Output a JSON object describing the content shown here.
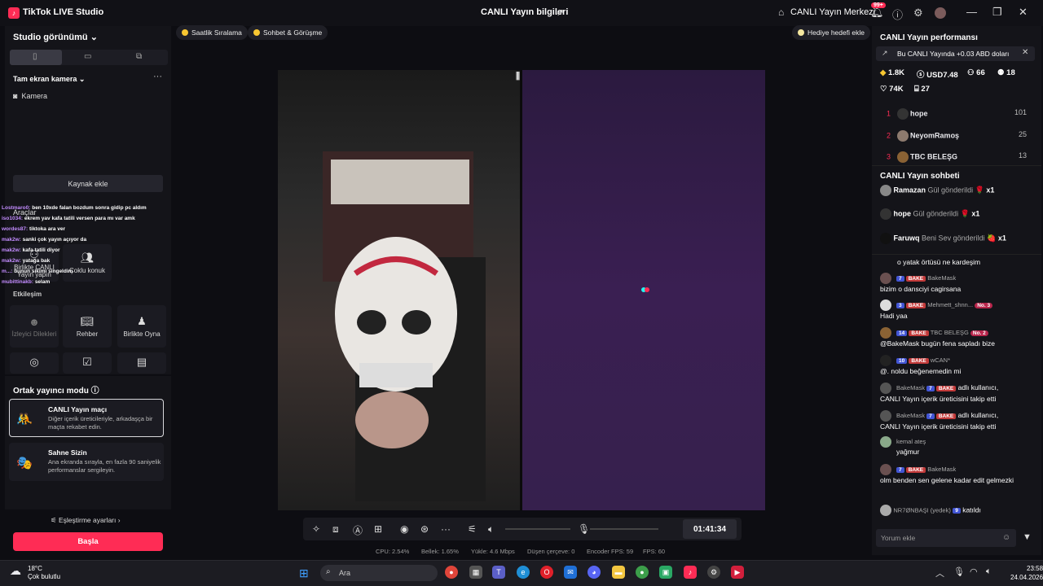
{
  "titlebar": {
    "app_name": "TikTok LIVE Studio",
    "center_title": "CANLI Yayın bilgileri",
    "live_center": "CANLI Yayın Merkezi",
    "notif_badge": "99+"
  },
  "left_panel": {
    "studio_view": "Studio görünümü",
    "fullscreen_camera": "Tam ekran kamera",
    "camera_source": "Kamera",
    "add_source": "Kaynak ekle",
    "tools": "Araçlar",
    "interaction": "Etkileşim",
    "tiles": [
      {
        "label": "İzleyici Dilekleri",
        "icon": "person-icon",
        "dim": true
      },
      {
        "label": "Rehber",
        "icon": "book-icon",
        "dim": false
      },
      {
        "label": "Birlikte Oyna",
        "icon": "joystick-icon",
        "dim": false
      }
    ],
    "tools_tiles": [
      {
        "label": "Birlikte CANLI Yayın yapın"
      },
      {
        "label": "Çoklu konuk"
      }
    ]
  },
  "chat_overlay": [
    {
      "user": "Lostmaro0:",
      "text": "ben 10xde falan bozdum sonra gidip pc aldım"
    },
    {
      "user": "iso1034:",
      "text": "ekrem yav kafa tatili versen para mı var amk"
    },
    {
      "user": "wordes87:",
      "text": "tiktoka ara ver"
    },
    {
      "user": "mak2w:",
      "text": "sanki çok yayın açıyor da"
    },
    {
      "user": "mak2w:",
      "text": "kafa tatili diyor"
    },
    {
      "user": "mak2w:",
      "text": "yatağa bak"
    },
    {
      "user": "m...:",
      "text": "bunun sikimi singeldim"
    },
    {
      "user": "mubittinakb:",
      "text": "selam"
    }
  ],
  "cohost": {
    "title": "Ortak yayıncı modu",
    "options": [
      {
        "title": "CANLI Yayın maçı",
        "desc": "Diğer içerik üreticileriyle, arkadaşça bir maçta rekabet edin."
      },
      {
        "title": "Sahne Sizin",
        "desc": "Ana ekranda sırayla, en fazla 90 saniyelik performanslar sergileyin."
      }
    ],
    "pairing_settings": "Eşleştirme ayarları",
    "start_button": "Başla"
  },
  "top_chips": {
    "hourly_ranking": "Saatlik Sıralama",
    "chat_meet": "Sohbet & Görüşme",
    "gift_goal": "Hediye hedefi ekle"
  },
  "controls": {
    "timer": "01:41:34"
  },
  "stats": [
    {
      "label": "CPU:",
      "value": "2.54%"
    },
    {
      "label": "Bellek:",
      "value": "1.65%"
    },
    {
      "label": "Yükle:",
      "value": "4.6 Mbps"
    },
    {
      "label": "Düşen çerçeve:",
      "value": "0"
    },
    {
      "label": "Encoder FPS:",
      "value": "59"
    },
    {
      "label": "FPS:",
      "value": "60"
    }
  ],
  "performance": {
    "title": "CANLI Yayın performansı",
    "banner": "Bu CANLI Yayında +0.03 ABD doları",
    "diamonds": "1.8K",
    "usd": "USD7.48",
    "viewers": "66",
    "new_followers": "18",
    "likes": "74K",
    "gifts": "27",
    "ranking": [
      {
        "rank": "1",
        "name": "hope",
        "score": "101"
      },
      {
        "rank": "2",
        "name": "NeyomRamoş",
        "score": "25"
      },
      {
        "rank": "3",
        "name": "TBC BELEŞG",
        "score": "13"
      }
    ]
  },
  "live_chat": {
    "title": "CANLI Yayın sohbeti",
    "gifts": [
      {
        "user": "Ramazan",
        "action": "Gül gönderildi",
        "count": "x1"
      },
      {
        "user": "hope",
        "action": "Gül gönderildi",
        "count": "x1"
      },
      {
        "user": "Faruwq",
        "action": "Beni Sev gönderildi",
        "count": "x1"
      }
    ],
    "partial_line": "o yatak örtüsü ne kardeşim",
    "messages": [
      {
        "level": "7",
        "badge": "BAKE",
        "user": "BakeMask",
        "no": "",
        "text": "bizim o dansciyi cagirsana"
      },
      {
        "level": "3",
        "badge": "BAKE",
        "user": "Mehmett_shnn...",
        "no": "No. 3",
        "text": "Hadi yaa"
      },
      {
        "level": "14",
        "badge": "BAKE",
        "user": "TBC BELEŞG",
        "no": "No. 2",
        "text": "@BakeMask bugün fena sapladı bize"
      },
      {
        "level": "10",
        "badge": "BAKE",
        "user": "wCAN*",
        "no": "",
        "text": "@. noldu beğenemedin mi"
      }
    ],
    "follow_events": [
      {
        "user": "BakeMask",
        "level": "7",
        "badge": "BAKE",
        "text1": "adlı kullanıcı,",
        "text2": "CANLI Yayın içerik üreticisini takip etti"
      },
      {
        "user": "BakeMask",
        "level": "7",
        "badge": "BAKE",
        "text1": "adlı kullanıcı,",
        "text2": "CANLI Yayın içerik üreticisini takip etti"
      }
    ],
    "late_messages": [
      {
        "user": "kemal ateş",
        "text": "yağmur"
      },
      {
        "user": "BakeMask",
        "level": "7",
        "badge": "BAKE",
        "text": "olm benden sen gelene kadar edit gelmezki"
      }
    ],
    "join": {
      "user": "NR7ØNBAŞI (yedek)",
      "level": "9",
      "text": "katıldı"
    },
    "comment_placeholder": "Yorum ekle"
  },
  "taskbar": {
    "temp": "18°C",
    "weather": "Çok bulutlu",
    "search": "Ara",
    "time": "23:58",
    "date": "24.04.2026"
  }
}
